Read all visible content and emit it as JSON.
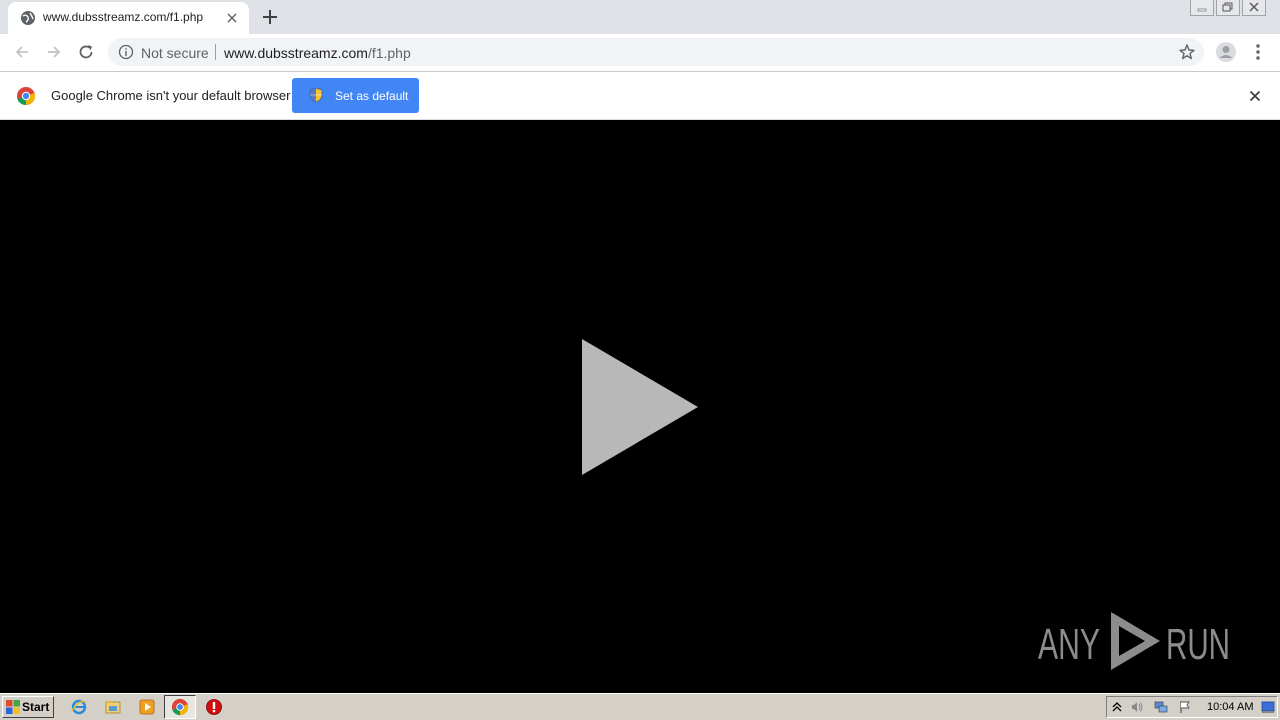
{
  "browser": {
    "tab": {
      "title": "www.dubsstreamz.com/f1.php"
    },
    "omnibox": {
      "security_label": "Not secure",
      "url_host": "www.dubsstreamz.com",
      "url_path": "/f1.php"
    }
  },
  "infobar": {
    "message": "Google Chrome isn't your default browser",
    "button_label": "Set as default"
  },
  "watermark": {
    "text": "ANY RUN"
  },
  "taskbar": {
    "start_label": "Start",
    "clock": "10:04 AM"
  },
  "colors": {
    "accent": "#4285f4",
    "content_bg": "#000000",
    "play_icon": "#b8b8b8"
  }
}
